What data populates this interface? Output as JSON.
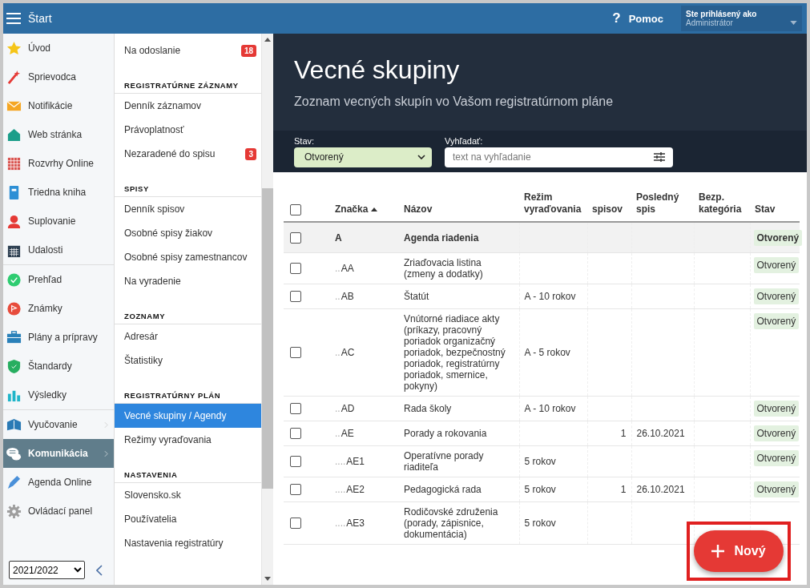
{
  "topbar": {
    "title": "Štart",
    "help_icon": "?",
    "help": "Pomoc",
    "user_label": "Ste prihlásený ako",
    "user_name": "Administrátor"
  },
  "sidebar": {
    "groups": [
      [
        {
          "label": "Úvod",
          "selected": false,
          "submenu": false
        },
        {
          "label": "Sprievodca",
          "selected": false,
          "submenu": false
        },
        {
          "label": "Notifikácie",
          "selected": false,
          "submenu": false
        },
        {
          "label": "Web stránka",
          "selected": false,
          "submenu": false
        },
        {
          "label": "Rozvrhy Online",
          "selected": false,
          "submenu": false
        },
        {
          "label": "Triedna kniha",
          "selected": false,
          "submenu": false
        },
        {
          "label": "Suplovanie",
          "selected": false,
          "submenu": false
        },
        {
          "label": "Udalosti",
          "selected": false,
          "submenu": false
        }
      ],
      [
        {
          "label": "Prehľad",
          "selected": false,
          "submenu": false
        },
        {
          "label": "Známky",
          "selected": false,
          "submenu": false
        },
        {
          "label": "Plány a prípravy",
          "selected": false,
          "submenu": false
        },
        {
          "label": "Štandardy",
          "selected": false,
          "submenu": false
        },
        {
          "label": "Výsledky",
          "selected": false,
          "submenu": false
        }
      ],
      [
        {
          "label": "Vyučovanie",
          "selected": false,
          "submenu": true
        },
        {
          "label": "Komunikácia",
          "selected": true,
          "submenu": true
        },
        {
          "label": "Agenda Online",
          "selected": false,
          "submenu": false
        },
        {
          "label": "Ovládací panel",
          "selected": false,
          "submenu": false
        }
      ]
    ],
    "year": "2021/2022"
  },
  "submenu": [
    {
      "items": [
        {
          "label": "Na odoslanie",
          "badge": "18",
          "selected": false
        }
      ]
    },
    {
      "heading": "REGISTRATÚRNE ZÁZNAMY",
      "items": [
        {
          "label": "Denník záznamov",
          "selected": false
        },
        {
          "label": "Právoplatnosť",
          "selected": false
        },
        {
          "label": "Nezaradené do spisu",
          "badge": "3",
          "selected": false
        }
      ]
    },
    {
      "heading": "SPISY",
      "items": [
        {
          "label": "Denník spisov",
          "selected": false
        },
        {
          "label": "Osobné spisy žiakov",
          "selected": false
        },
        {
          "label": "Osobné spisy zamestnancov",
          "selected": false
        },
        {
          "label": "Na vyradenie",
          "selected": false
        }
      ]
    },
    {
      "heading": "ZOZNAMY",
      "items": [
        {
          "label": "Adresár",
          "selected": false
        },
        {
          "label": "Štatistiky",
          "selected": false
        }
      ]
    },
    {
      "heading": "REGISTRATÚRNY PLÁN",
      "items": [
        {
          "label": "Vecné skupiny / Agendy",
          "selected": true
        },
        {
          "label": "Režimy vyraďovania",
          "selected": false
        }
      ]
    },
    {
      "heading": "NASTAVENIA",
      "items": [
        {
          "label": "Slovensko.sk",
          "selected": false
        },
        {
          "label": "Používatelia",
          "selected": false
        },
        {
          "label": "Nastavenia registratúry",
          "selected": false
        }
      ]
    }
  ],
  "page": {
    "title": "Vecné skupiny",
    "subtitle": "Zoznam vecných skupín vo Vašom registratúrnom pláne",
    "filters": {
      "status_label": "Stav:",
      "status_value": "Otvorený",
      "search_label": "Vyhľadať:",
      "search_placeholder": "text na vyhľadanie"
    }
  },
  "table": {
    "select_all_checked": false,
    "columns": [
      "Značka",
      "Názov",
      "Režim vyraďovania",
      "spisov",
      "Posledný spis",
      "Bezp. kategória",
      "Stav"
    ],
    "rows": [
      {
        "kind": "group",
        "checked": false,
        "code": "A",
        "name": "Agenda riadenia",
        "status": "Otvorený"
      },
      {
        "kind": "item",
        "checked": false,
        "prefix": "..",
        "code": "AA",
        "name": "Zriaďovacia listina (zmeny a dodatky)",
        "status": "Otvorený"
      },
      {
        "kind": "item",
        "checked": false,
        "prefix": "..",
        "code": "AB",
        "name": "Štatút",
        "regime": "A - 10 rokov",
        "status": "Otvorený"
      },
      {
        "kind": "item",
        "checked": false,
        "prefix": "..",
        "code": "AC",
        "name": "Vnútorné riadiace akty (príkazy, pracovný poriadok organizačný poriadok, bezpečnostný poriadok, registratúrny poriadok, smernice, pokyny)",
        "regime": "A - 5 rokov",
        "status": "Otvorený"
      },
      {
        "kind": "item",
        "checked": false,
        "prefix": "..",
        "code": "AD",
        "name": "Rada školy",
        "regime": "A - 10 rokov",
        "status": "Otvorený"
      },
      {
        "kind": "item",
        "checked": false,
        "prefix": "..",
        "code": "AE",
        "name": "Porady a rokovania",
        "count": "1",
        "last": "26.10.2021",
        "status": "Otvorený"
      },
      {
        "kind": "item",
        "checked": false,
        "prefix": "....",
        "code": "AE1",
        "name": "Operatívne porady riaditeľa",
        "regime": "5 rokov",
        "status": "Otvorený"
      },
      {
        "kind": "item",
        "checked": false,
        "prefix": "....",
        "code": "AE2",
        "name": "Pedagogická rada",
        "regime": "5 rokov",
        "count": "1",
        "last": "26.10.2021",
        "status": "Otvorený"
      },
      {
        "kind": "item",
        "checked": false,
        "prefix": "....",
        "code": "AE3",
        "name": "Rodičovské združenia (porady, zápisnice, dokumentácia)",
        "regime": "5 rokov"
      }
    ]
  },
  "fab": {
    "label": "Nový",
    "highlighted": true
  }
}
